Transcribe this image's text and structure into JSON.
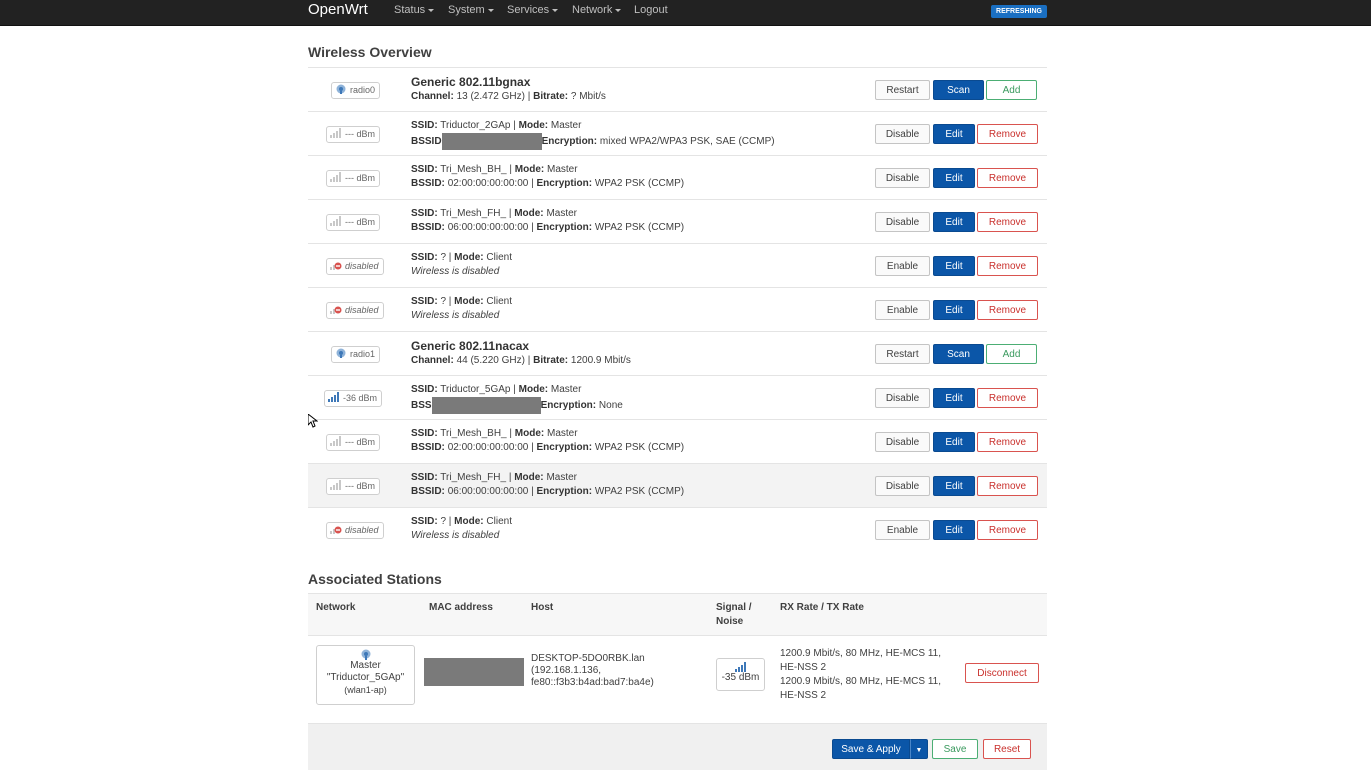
{
  "nav": {
    "brand": "OpenWrt",
    "items": [
      "Status",
      "System",
      "Services",
      "Network"
    ],
    "logout": "Logout",
    "indicator": "REFRESHING"
  },
  "wireless": {
    "title": "Wireless Overview",
    "radios": [
      {
        "badge": "radio0",
        "name": "Generic 802.11bgnax",
        "channel_label": "Channel:",
        "channel": "13 (2.472 GHz)",
        "bitrate_label": "Bitrate:",
        "bitrate": "? Mbit/s",
        "buttons": [
          "Restart",
          "Scan",
          "Add"
        ]
      },
      {
        "badge": "radio1",
        "name": "Generic 802.11nacax",
        "channel_label": "Channel:",
        "channel": "44 (5.220 GHz)",
        "bitrate_label": "Bitrate:",
        "bitrate": "1200.9 Mbit/s",
        "buttons": [
          "Restart",
          "Scan",
          "Add"
        ]
      }
    ],
    "networks": [
      {
        "signal": "--- dBm",
        "ssid": "Triductor_2GAp",
        "mode": "Master",
        "bssid_label": "BSSID",
        "bssid": "",
        "encryption": "mixed WPA2/WPA3 PSK, SAE (CCMP)",
        "toggle": "Disable"
      },
      {
        "signal": "--- dBm",
        "ssid": "Tri_Mesh_BH_",
        "mode": "Master",
        "bssid_label": "BSSID:",
        "bssid": "02:00:00:00:00:00",
        "encryption": "WPA2 PSK (CCMP)",
        "toggle": "Disable"
      },
      {
        "signal": "--- dBm",
        "ssid": "Tri_Mesh_FH_",
        "mode": "Master",
        "bssid_label": "BSSID:",
        "bssid": "06:00:00:00:00:00",
        "encryption": "WPA2 PSK (CCMP)",
        "toggle": "Disable"
      },
      {
        "signal": "disabled",
        "ssid": "?",
        "mode": "Client",
        "note": "Wireless is disabled",
        "toggle": "Enable"
      },
      {
        "signal": "disabled",
        "ssid": "?",
        "mode": "Client",
        "note": "Wireless is disabled",
        "toggle": "Enable"
      },
      {
        "signal": "-36 dBm",
        "ssid": "Triductor_5GAp",
        "mode": "Master",
        "bssid_label": "BSS",
        "bssid": "",
        "encryption": "None",
        "toggle": "Disable"
      },
      {
        "signal": "--- dBm",
        "ssid": "Tri_Mesh_BH_",
        "mode": "Master",
        "bssid_label": "BSSID:",
        "bssid": "02:00:00:00:00:00",
        "encryption": "WPA2 PSK (CCMP)",
        "toggle": "Disable"
      },
      {
        "signal": "--- dBm",
        "ssid": "Tri_Mesh_FH_",
        "mode": "Master",
        "bssid_label": "BSSID:",
        "bssid": "06:00:00:00:00:00",
        "encryption": "WPA2 PSK (CCMP)",
        "toggle": "Disable"
      },
      {
        "signal": "disabled",
        "ssid": "?",
        "mode": "Client",
        "note": "Wireless is disabled",
        "toggle": "Enable"
      }
    ],
    "labels": {
      "ssid": "SSID:",
      "mode": "Mode:",
      "encryption": "Encryption:",
      "edit": "Edit",
      "remove": "Remove"
    }
  },
  "stations": {
    "title": "Associated Stations",
    "headers": {
      "network": "Network",
      "mac": "MAC address",
      "host": "Host",
      "signal_1": "Signal /",
      "signal_2": "Noise",
      "rate": "RX Rate / TX Rate"
    },
    "row": {
      "net_mode": "Master",
      "net_ssid": "\"Triductor_5GAp\"",
      "net_iface": "(wlan1-ap)",
      "host_1": "DESKTOP-5DO0RBK.lan",
      "host_2": "(192.168.1.136,",
      "host_3": "fe80::f3b3:b4ad:bad7:ba4e)",
      "signal": "-35 dBm",
      "rx_1": "1200.9 Mbit/s, 80 MHz, HE-MCS 11,",
      "rx_2": "HE-NSS 2",
      "tx_1": "1200.9 Mbit/s, 80 MHz, HE-MCS 11,",
      "tx_2": "HE-NSS 2",
      "action": "Disconnect"
    }
  },
  "footer": {
    "save_apply": "Save & Apply",
    "save": "Save",
    "reset": "Reset"
  },
  "colors": {
    "primary": "#0b56a8",
    "positive": "#3a9a5e",
    "negative": "#c9302c",
    "topbar": "#222222"
  }
}
